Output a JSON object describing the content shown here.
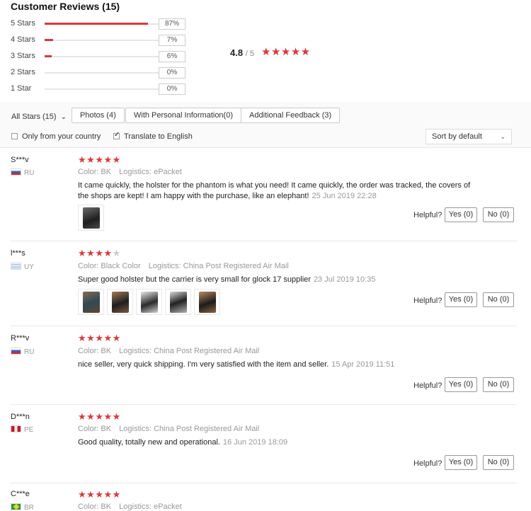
{
  "header": {
    "title": "Customer Reviews (15)"
  },
  "distribution": [
    {
      "label": "5 Stars",
      "percent": "87%",
      "fill": 0.87
    },
    {
      "label": "4 Stars",
      "percent": "7%",
      "fill": 0.07
    },
    {
      "label": "3 Stars",
      "percent": "6%",
      "fill": 0.06
    },
    {
      "label": "2 Stars",
      "percent": "0%",
      "fill": 0.0
    },
    {
      "label": "1 Star",
      "percent": "0%",
      "fill": 0.0
    }
  ],
  "average": {
    "value": "4.8",
    "suffix": "/ 5",
    "stars": "★★★★★"
  },
  "filters": {
    "all_stars": "All Stars (15)",
    "all_stars_chevron": "⌄",
    "buttons": [
      "Photos (4)",
      "With Personal Information(0)",
      "Additional Feedback (3)"
    ],
    "checkboxes": [
      {
        "label": "Only from your country",
        "checked": false
      },
      {
        "label": "Translate to English",
        "checked": true
      }
    ],
    "sort": {
      "value": "Sort by default",
      "chevron": "⌄"
    }
  },
  "helpful_label": "Helpful?",
  "colors": {
    "accent": "#e23636",
    "muted": "#999999"
  },
  "reviews": [
    {
      "user": "S***v",
      "country": "RU",
      "rating": 5,
      "color_key": "Color:",
      "color_val": "BK",
      "logistics_key": "Logistics:",
      "logistics_val": "ePacket",
      "text": "It came quickly, the holster for the phantom is what you need! It came quickly, the order was tracked, the covers of the shops are kept! I am happy with the purchase, like an elephant!",
      "date": "25 Jun 2019 22:28",
      "photos": 1,
      "yes": "Yes (0)",
      "no": "No (0)"
    },
    {
      "user": "l***s",
      "country": "UY",
      "rating": 4,
      "color_key": "Color:",
      "color_val": "Black Color",
      "logistics_key": "Logistics:",
      "logistics_val": "China Post Registered Air Mail",
      "text": "Super good holster but the carrier is very small for glock 17 supplier",
      "date": "23 Jul 2019 10:35",
      "photos": 5,
      "yes": "Yes (0)",
      "no": "No (0)"
    },
    {
      "user": "R***v",
      "country": "RU",
      "rating": 5,
      "color_key": "Color:",
      "color_val": "BK",
      "logistics_key": "Logistics:",
      "logistics_val": "China Post Registered Air Mail",
      "text": "nice seller, very quick shipping. I'm very satisfied with the item and seller.",
      "date": "15 Apr 2019 11:51",
      "photos": 0,
      "yes": "Yes (0)",
      "no": "No (0)"
    },
    {
      "user": "D***n",
      "country": "PE",
      "rating": 5,
      "color_key": "Color:",
      "color_val": "BK",
      "logistics_key": "Logistics:",
      "logistics_val": "China Post Registered Air Mail",
      "text": "Good quality, totally new and operational.",
      "date": "16 Jun 2019 18:09",
      "photos": 0,
      "yes": "Yes (0)",
      "no": "No (0)"
    },
    {
      "user": "C***e",
      "country": "BR",
      "rating": 5,
      "color_key": "Color:",
      "color_val": "BK",
      "logistics_key": "Logistics:",
      "logistics_val": "ePacket"
    }
  ]
}
